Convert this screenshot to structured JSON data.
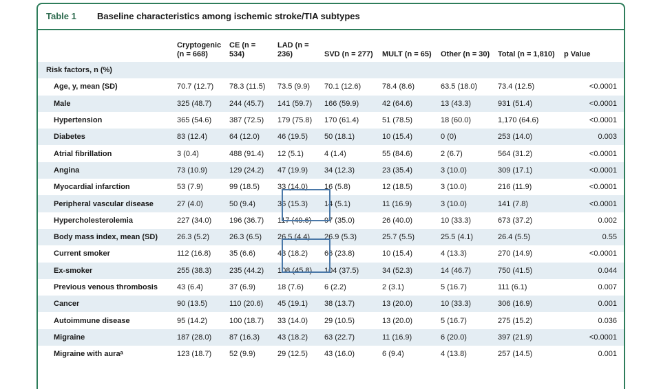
{
  "table": {
    "label": "Table 1",
    "title": "Baseline characteristics among ischemic stroke/TIA subtypes",
    "columns": [
      "",
      "Cryptogenic (n = 668)",
      "CE (n = 534)",
      "LAD (n = 236)",
      "SVD (n = 277)",
      "MULT (n = 65)",
      "Other (n = 30)",
      "Total (n = 1,810)",
      "p Value"
    ],
    "rows": [
      [
        "Risk factors, n (%)",
        "",
        "",
        "",
        "",
        "",
        "",
        "",
        ""
      ],
      [
        "Age, y, mean (SD)",
        "70.7 (12.7)",
        "78.3 (11.5)",
        "73.5 (9.9)",
        "70.1 (12.6)",
        "78.4 (8.6)",
        "63.5 (18.0)",
        "73.4 (12.5)",
        "<0.0001"
      ],
      [
        "Male",
        "325 (48.7)",
        "244 (45.7)",
        "141 (59.7)",
        "166 (59.9)",
        "42 (64.6)",
        "13 (43.3)",
        "931 (51.4)",
        "<0.0001"
      ],
      [
        "Hypertension",
        "365 (54.6)",
        "387 (72.5)",
        "179 (75.8)",
        "170 (61.4)",
        "51 (78.5)",
        "18 (60.0)",
        "1,170 (64.6)",
        "<0.0001"
      ],
      [
        "Diabetes",
        "83 (12.4)",
        "64 (12.0)",
        "46 (19.5)",
        "50 (18.1)",
        "10 (15.4)",
        "0 (0)",
        "253 (14.0)",
        "0.003"
      ],
      [
        "Atrial fibrillation",
        "3 (0.4)",
        "488 (91.4)",
        "12 (5.1)",
        "4 (1.4)",
        "55 (84.6)",
        "2 (6.7)",
        "564 (31.2)",
        "<0.0001"
      ],
      [
        "Angina",
        "73 (10.9)",
        "129 (24.2)",
        "47 (19.9)",
        "34 (12.3)",
        "23 (35.4)",
        "3 (10.0)",
        "309 (17.1)",
        "<0.0001"
      ],
      [
        "Myocardial infarction",
        "53 (7.9)",
        "99 (18.5)",
        "33 (14.0)",
        "16 (5.8)",
        "12 (18.5)",
        "3 (10.0)",
        "216 (11.9)",
        "<0.0001"
      ],
      [
        "Peripheral vascular disease",
        "27 (4.0)",
        "50 (9.4)",
        "36 (15.3)",
        "14 (5.1)",
        "11 (16.9)",
        "3 (10.0)",
        "141 (7.8)",
        "<0.0001"
      ],
      [
        "Hypercholesterolemia",
        "227 (34.0)",
        "196 (36.7)",
        "117 (49.6)",
        "97 (35.0)",
        "26 (40.0)",
        "10 (33.3)",
        "673 (37.2)",
        "0.002"
      ],
      [
        "Body mass index, mean (SD)",
        "26.3 (5.2)",
        "26.3 (6.5)",
        "26.5 (4.4)",
        "26.9 (5.3)",
        "25.7 (5.5)",
        "25.5 (4.1)",
        "26.4 (5.5)",
        "0.55"
      ],
      [
        "Current smoker",
        "112 (16.8)",
        "35 (6.6)",
        "43 (18.2)",
        "66 (23.8)",
        "10 (15.4)",
        "4 (13.3)",
        "270 (14.9)",
        "<0.0001"
      ],
      [
        "Ex-smoker",
        "255 (38.3)",
        "235 (44.2)",
        "108 (45.8)",
        "104 (37.5)",
        "34 (52.3)",
        "14 (46.7)",
        "750 (41.5)",
        "0.044"
      ],
      [
        "Previous venous thrombosis",
        "43 (6.4)",
        "37 (6.9)",
        "18 (7.6)",
        "6 (2.2)",
        "2 (3.1)",
        "5 (16.7)",
        "111 (6.1)",
        "0.007"
      ],
      [
        "Cancer",
        "90 (13.5)",
        "110 (20.6)",
        "45 (19.1)",
        "38 (13.7)",
        "13 (20.0)",
        "10 (33.3)",
        "306 (16.9)",
        "0.001"
      ],
      [
        "Autoimmune disease",
        "95 (14.2)",
        "100 (18.7)",
        "33 (14.0)",
        "29 (10.5)",
        "13 (20.0)",
        "5 (16.7)",
        "275 (15.2)",
        "0.036"
      ],
      [
        "Migraine",
        "187 (28.0)",
        "87 (16.3)",
        "43 (18.2)",
        "63 (22.7)",
        "11 (16.9)",
        "6 (20.0)",
        "397 (21.9)",
        "<0.0001"
      ],
      [
        "Migraine with auraᵃ",
        "123 (18.7)",
        "52 (9.9)",
        "29 (12.5)",
        "43 (16.0)",
        "6 (9.4)",
        "4 (13.8)",
        "257 (14.5)",
        "0.001"
      ]
    ]
  },
  "colors": {
    "border": "#2e7d5b",
    "stripe": "#e4edf3",
    "highlight": "#4a78a8"
  }
}
